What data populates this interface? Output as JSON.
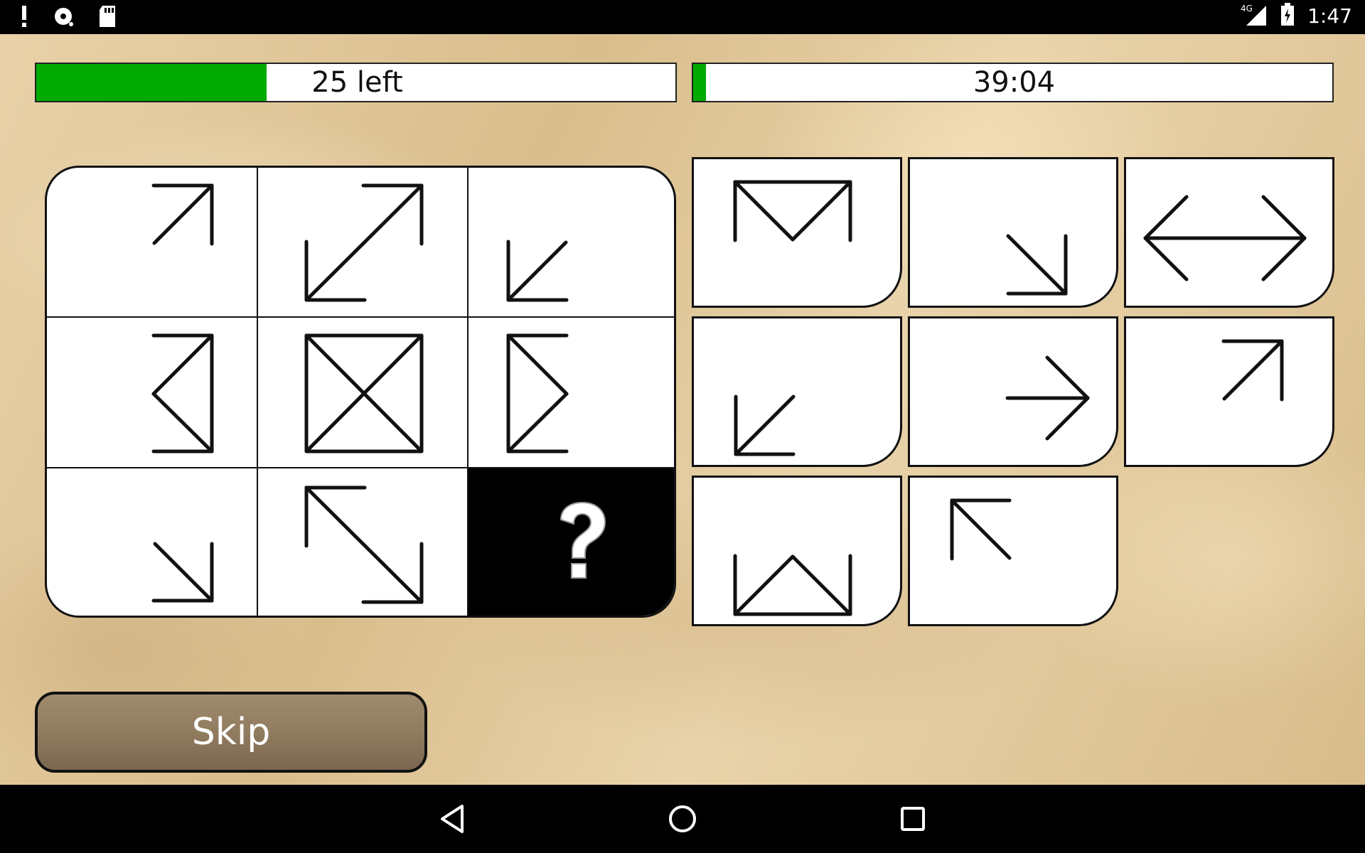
{
  "status_bar": {
    "time": "1:47",
    "network": "4G",
    "icons": [
      "alert-icon",
      "disc-icon",
      "sd-card-icon",
      "signal-icon",
      "battery-icon"
    ]
  },
  "progress": {
    "label": "25 left",
    "fraction": 0.36
  },
  "timer": {
    "label": "39:04",
    "fraction": 0.02
  },
  "colors": {
    "accent_green": "#00aa00",
    "puzzle_black": "#000000"
  },
  "puzzle": {
    "cells": [
      "arrow-up-right-icon",
      "double-arrow-diagonal-icon",
      "arrow-down-left-icon",
      "left-pointing-triangle-icon",
      "crossed-box-icon",
      "right-pointing-triangle-icon",
      "arrow-down-right-icon",
      "double-arrow-antidiagonal-icon",
      "question-mark-icon"
    ]
  },
  "options": [
    "m-shape-icon",
    "arrow-down-right-icon",
    "double-arrow-horizontal-icon",
    "arrow-down-left-icon",
    "arrow-right-icon",
    "arrow-up-right-icon",
    "w-triangle-shape-icon",
    "arrow-up-left-icon"
  ],
  "skip_button": {
    "label": "Skip"
  },
  "nav_bar": {
    "icons": [
      "back-icon",
      "home-icon",
      "recents-icon"
    ]
  }
}
